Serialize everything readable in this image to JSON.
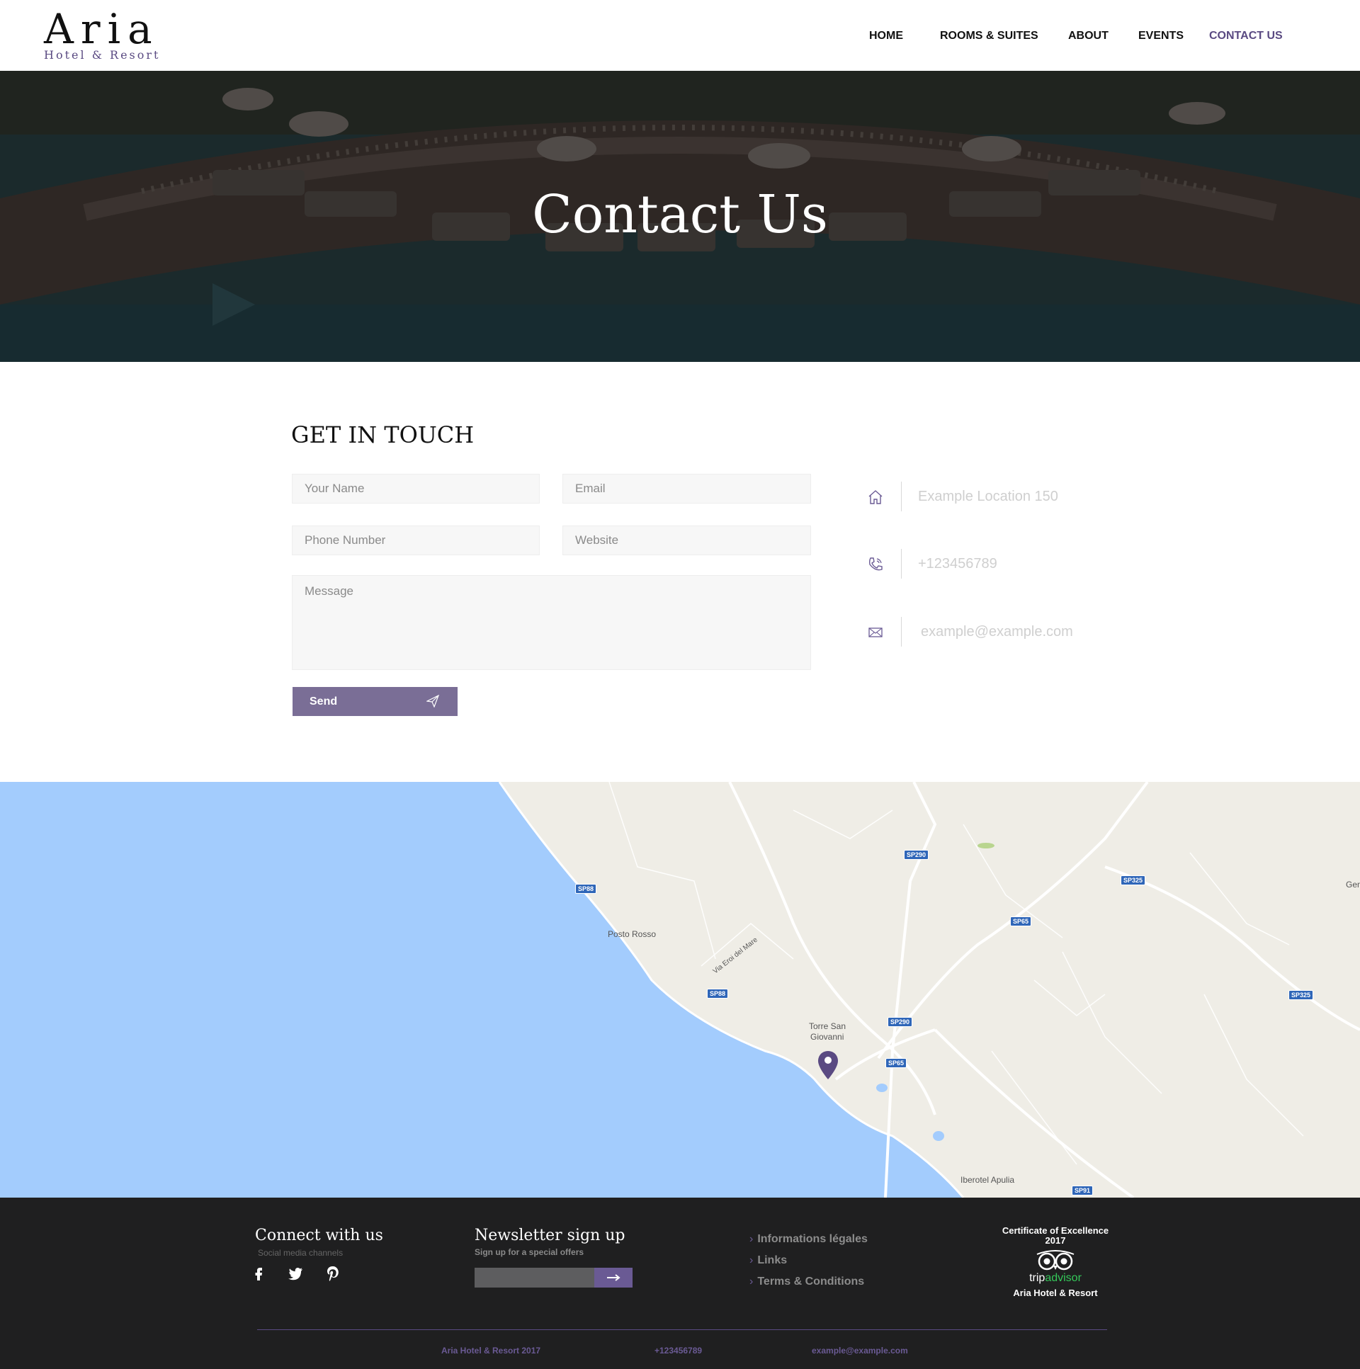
{
  "header": {
    "logo_main": "Aria",
    "logo_sub": "Hotel & Resort",
    "nav": [
      {
        "label": "HOME"
      },
      {
        "label": "ROOMS & SUITES"
      },
      {
        "label": "ABOUT"
      },
      {
        "label": "EVENTS"
      },
      {
        "label": "CONTACT US",
        "active": true
      }
    ]
  },
  "hero": {
    "title": "Contact Us"
  },
  "contact": {
    "title": "GET IN TOUCH",
    "fields": {
      "name_placeholder": "Your Name",
      "email_placeholder": "Email",
      "phone_placeholder": "Phone Number",
      "website_placeholder": "Website",
      "message_placeholder": "Message"
    },
    "send_label": "Send",
    "info": {
      "address": "Example Location 150",
      "phone": "+123456789",
      "email": "example@example.com"
    }
  },
  "map": {
    "labels": {
      "posto_rosso": "Posto Rosso",
      "torre_1": "Torre San",
      "torre_2": "Giovanni",
      "iberotel": "Iberotel Apulia",
      "via_eroi": "Via Eroi del Mare",
      "gen": "Gen"
    },
    "badges": [
      "SP290",
      "SP325",
      "SP88",
      "SP65",
      "SP88",
      "SP290",
      "SP65",
      "SP325",
      "SP91"
    ],
    "accent": "#5a4a82"
  },
  "footer": {
    "connect_title": "Connect with us",
    "connect_sub": "Social media channels",
    "newsletter_title": "Newsletter sign up",
    "newsletter_sub": "Sign up for a special offers",
    "links": [
      "Informations légales",
      "Links",
      "Terms & Conditions"
    ],
    "cert_line1": "Certificate of Excellence",
    "cert_line2": "2017",
    "trip": "trip",
    "advisor": "advisor",
    "cert_name": "Aria Hotel & Resort",
    "bottom_copyright": "Aria Hotel & Resort 2017",
    "bottom_phone": "+123456789",
    "bottom_email": "example@example.com"
  },
  "colors": {
    "brand": "#5a4a82",
    "button": "#7a6e96",
    "sea": "#a3ccfd",
    "footer_bg": "#1f1f20"
  }
}
